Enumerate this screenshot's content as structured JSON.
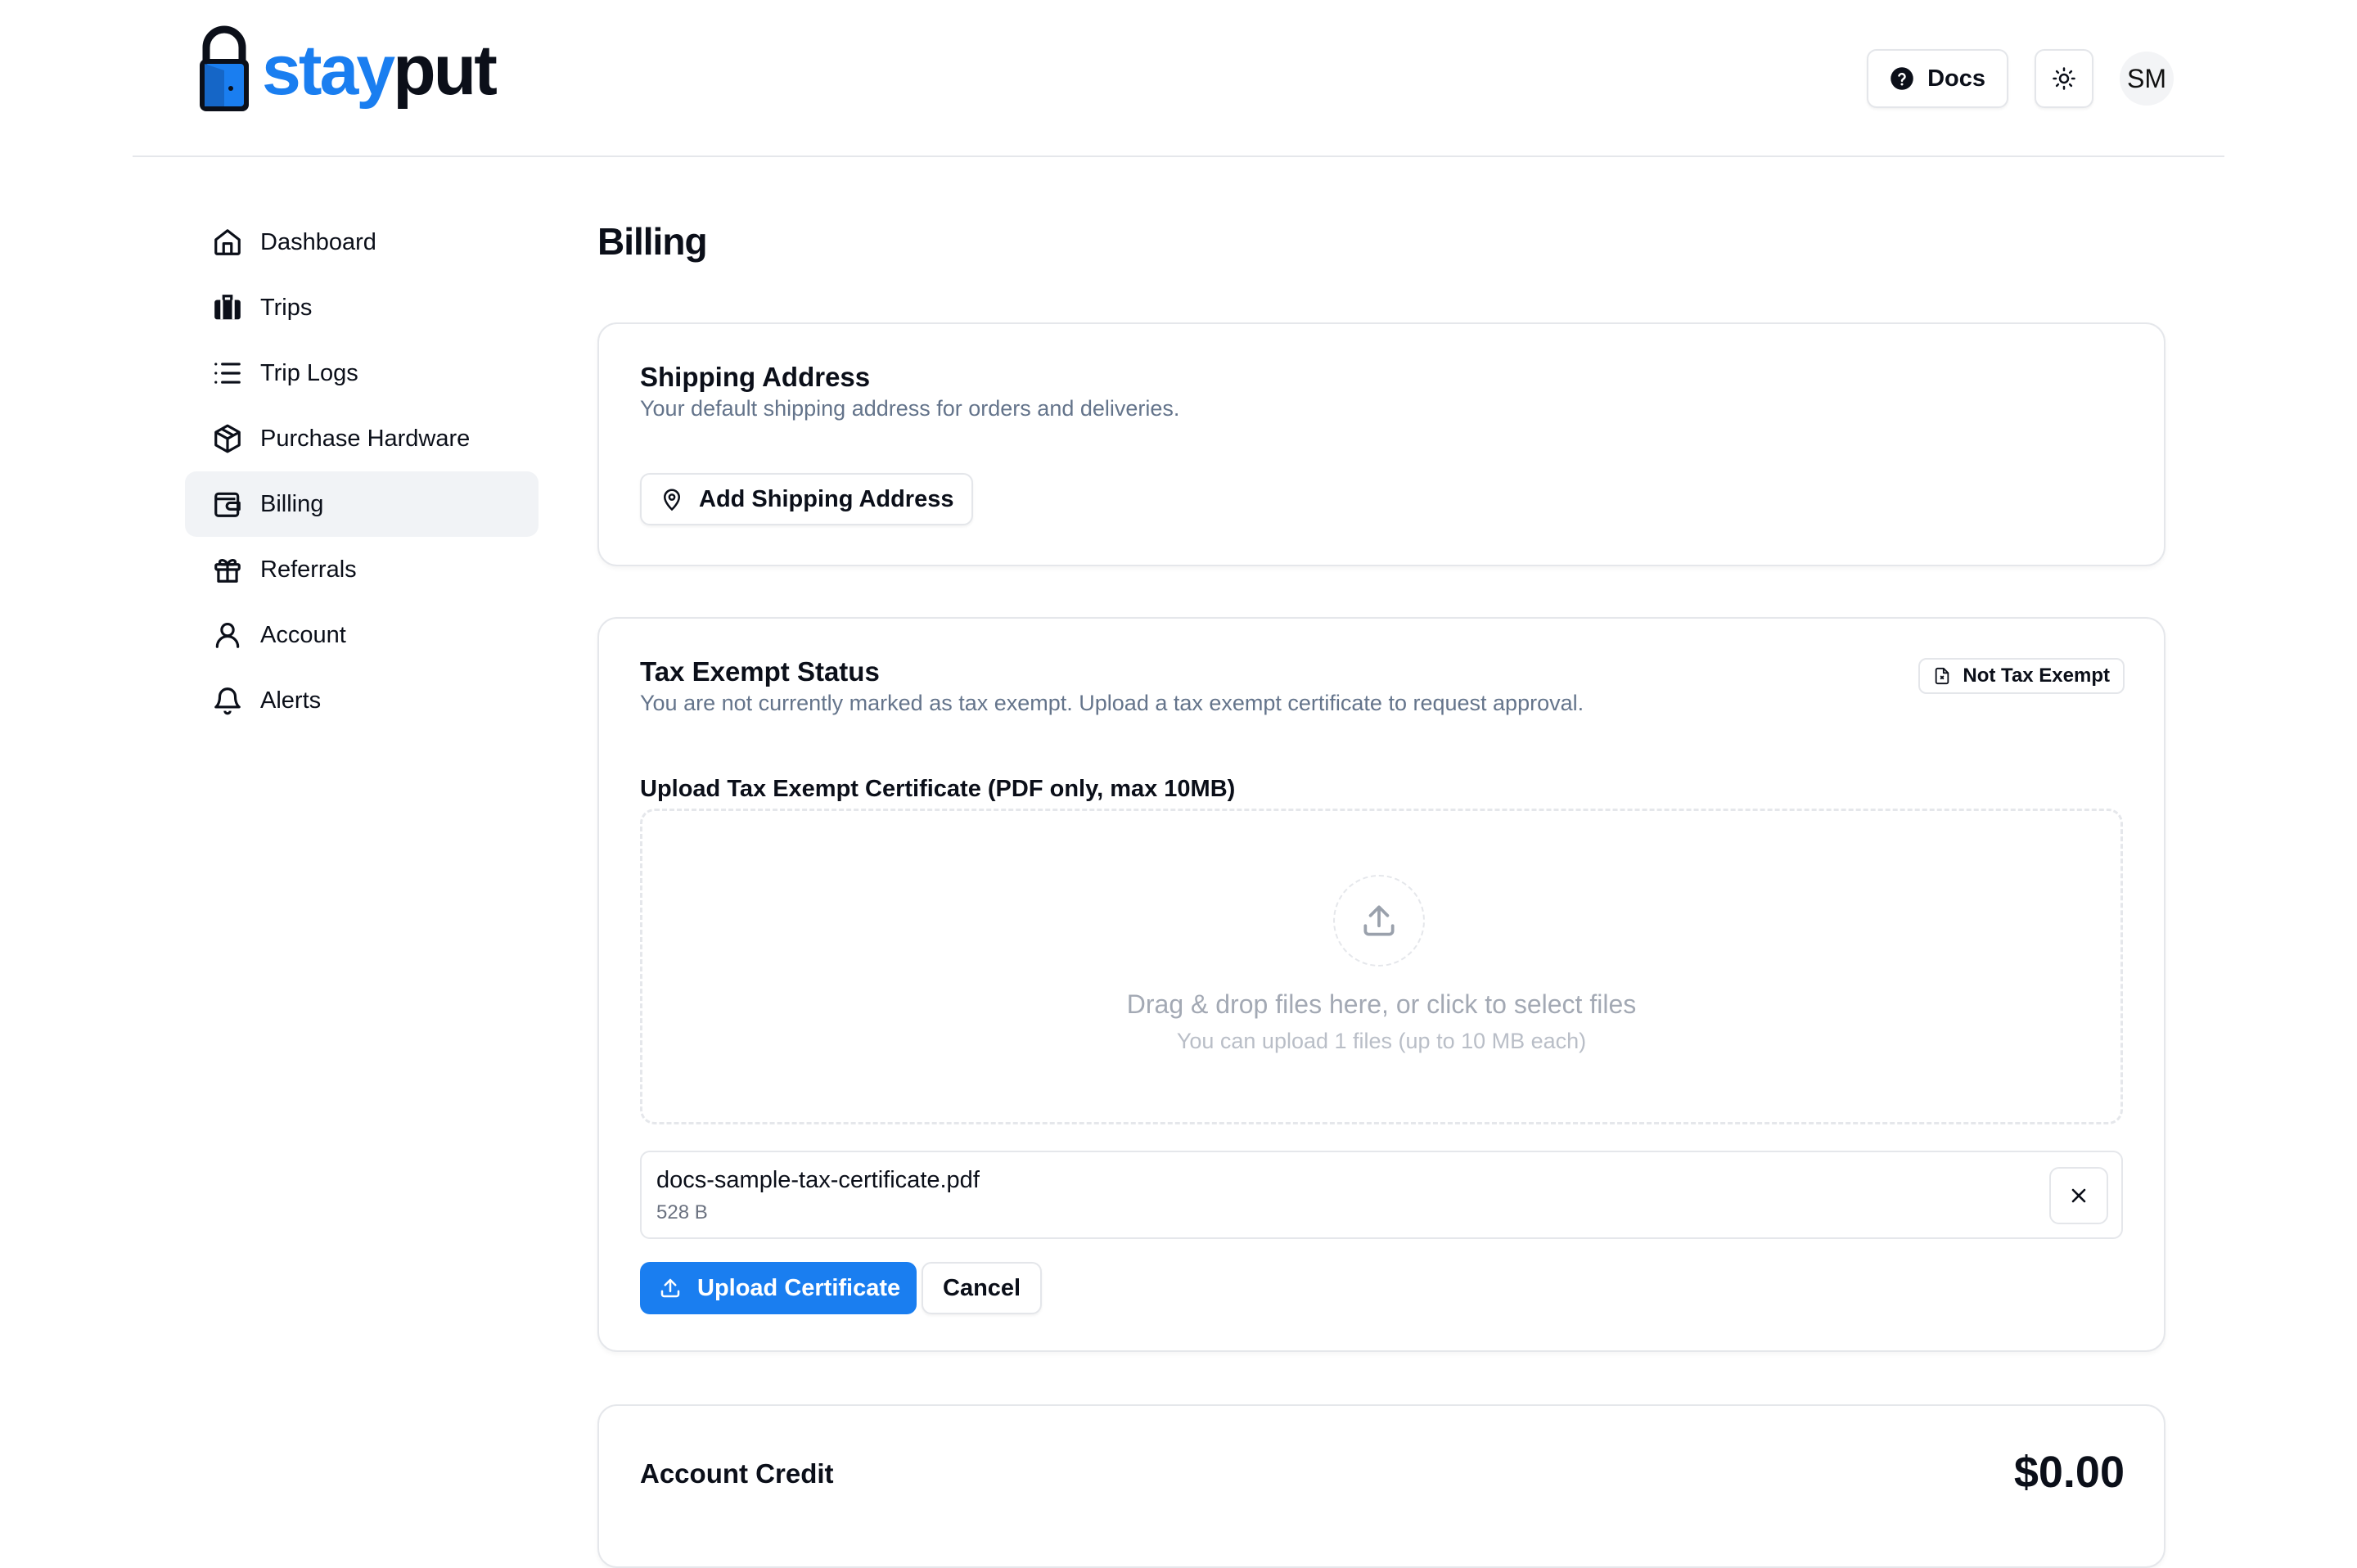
{
  "brand": {
    "name_part1": "stay",
    "name_part2": "put",
    "accent_color": "#1a7ef0"
  },
  "header": {
    "docs_label": "Docs",
    "theme_icon": "sun-icon",
    "avatar_initials": "SM"
  },
  "sidebar": {
    "items": [
      {
        "label": "Dashboard",
        "icon": "home-icon",
        "active": false
      },
      {
        "label": "Trips",
        "icon": "luggage-icon",
        "active": false
      },
      {
        "label": "Trip Logs",
        "icon": "list-icon",
        "active": false
      },
      {
        "label": "Purchase Hardware",
        "icon": "package-icon",
        "active": false
      },
      {
        "label": "Billing",
        "icon": "wallet-icon",
        "active": true
      },
      {
        "label": "Referrals",
        "icon": "gift-icon",
        "active": false
      },
      {
        "label": "Account",
        "icon": "user-icon",
        "active": false
      },
      {
        "label": "Alerts",
        "icon": "bell-icon",
        "active": false
      }
    ]
  },
  "page": {
    "title": "Billing"
  },
  "shipping": {
    "title": "Shipping Address",
    "description": "Your default shipping address for orders and deliveries.",
    "add_button": "Add Shipping Address"
  },
  "tax": {
    "title": "Tax Exempt Status",
    "description": "You are not currently marked as tax exempt. Upload a tax exempt certificate to request approval.",
    "badge": "Not Tax Exempt",
    "upload_label": "Upload Tax Exempt Certificate (PDF only, max 10MB)",
    "dropzone_main": "Drag & drop files here, or click to select files",
    "dropzone_sub": "You can upload 1 files (up to 10 MB each)",
    "file": {
      "name": "docs-sample-tax-certificate.pdf",
      "size": "528 B"
    },
    "upload_button": "Upload Certificate",
    "cancel_button": "Cancel"
  },
  "credit": {
    "title": "Account Credit",
    "amount": "$0.00"
  }
}
